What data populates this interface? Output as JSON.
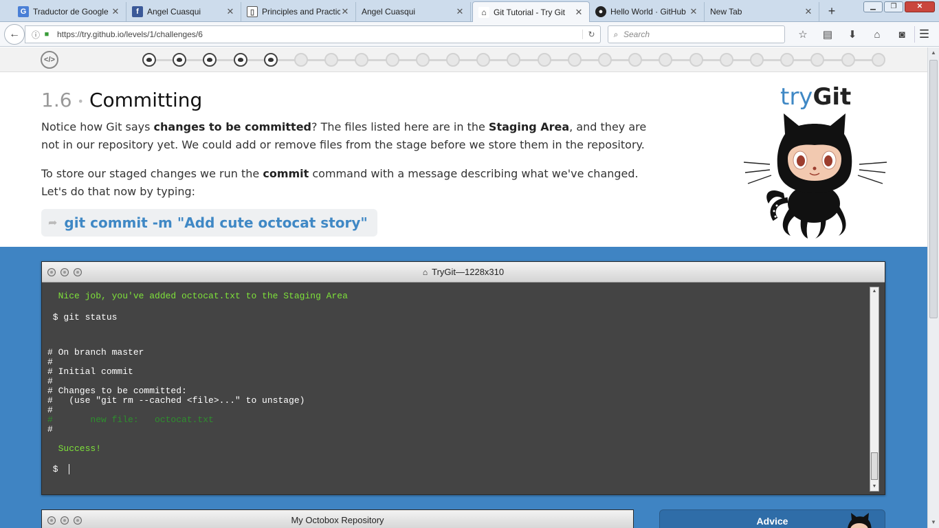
{
  "browser": {
    "tabs": [
      {
        "title": "Traductor de Google",
        "icon": "google-translate-icon",
        "color": "#4a7fd6"
      },
      {
        "title": "Angel Cuasqui",
        "icon": "facebook-icon",
        "color": "#3b5998"
      },
      {
        "title": "Principles and Practic",
        "icon": "book-icon",
        "color": "#555555"
      },
      {
        "title": "Angel Cuasqui",
        "icon": "",
        "color": ""
      },
      {
        "title": "Git Tutorial - Try Git",
        "icon": "octocat-icon",
        "color": "#222222",
        "active": true
      },
      {
        "title": "Hello World · GitHub",
        "icon": "github-icon",
        "color": "#222222"
      },
      {
        "title": "New Tab",
        "icon": "",
        "color": ""
      }
    ],
    "url": "https://try.github.io/levels/1/challenges/6",
    "search_placeholder": "Search"
  },
  "progress": {
    "total": 25,
    "completed": 5
  },
  "lesson": {
    "number": "1.6",
    "title": "Committing",
    "p1_a": "Notice how Git says ",
    "p1_b": "changes to be committed",
    "p1_c": "? The files listed here are in the ",
    "p1_d": "Staging Area",
    "p1_e": ", and they are not in our repository yet. We could add or remove files from the stage before we store them in the repository.",
    "p2_a": "To store our staged changes we run the ",
    "p2_b": "commit",
    "p2_c": " command with a message describing what we've changed. Let's do that now by typing:",
    "command": "git commit -m \"Add cute octocat story\""
  },
  "brand": {
    "try": "try",
    "git": "Git"
  },
  "terminal": {
    "title": "TryGit—1228x310",
    "lines": [
      "  Nice job, you've added octocat.txt to the Staging Area",
      " $ git status",
      "# On branch master",
      "#",
      "# Initial commit",
      "#",
      "# Changes to be committed:",
      "#   (use \"git rm --cached <file>...\" to unstage)",
      "#",
      "#       new file:   octocat.txt",
      "#",
      "  Success!",
      " $ "
    ]
  },
  "octobox": {
    "title": "My Octobox Repository"
  },
  "advice": {
    "label": "Advice"
  },
  "colors": {
    "accent_blue": "#3f88c5",
    "page_blue": "#3f84c3",
    "terminal_bg": "#444444",
    "terminal_green": "#7ee23a"
  }
}
